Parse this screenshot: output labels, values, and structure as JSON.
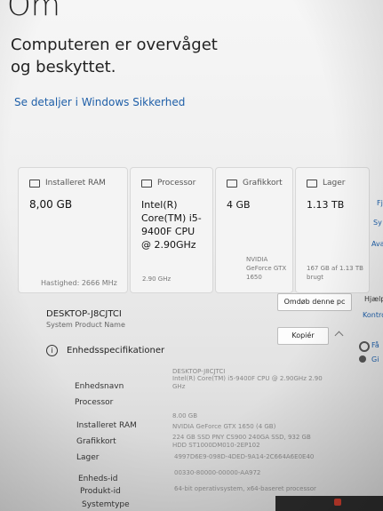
{
  "header": {
    "title": "Om",
    "status_headline": "Computeren er overvåget og beskyttet.",
    "security_link": "Se detaljer i Windows Sikkerhed"
  },
  "cards": [
    {
      "icon": "ram-icon",
      "label": "Installeret RAM",
      "value": "8,00 GB",
      "sub": ""
    },
    {
      "icon": "processor-icon",
      "label": "Processor",
      "value": "Intel(R) Core(TM) i5-9400F CPU @ 2.90GHz",
      "sub": ""
    },
    {
      "icon": "gpu-icon",
      "label": "Grafikkort",
      "value": "4 GB",
      "sub": "NVIDIA GeForce GTX 1650"
    },
    {
      "icon": "storage-icon",
      "label": "Lager",
      "value": "1.13 TB",
      "sub": "167 GB af 1.13 TB brugt"
    }
  ],
  "card_footers": {
    "ram_speed": "Hastighed: 2666 MHz",
    "cpu_speed": "2.90 GHz"
  },
  "side_links": {
    "fj": "Fj",
    "sy": "Sy",
    "ava": "Ava",
    "help": "Hjælp",
    "kontro": "Kontro",
    "fa": "Få",
    "gi": "Gi"
  },
  "device": {
    "name": "DESKTOP-J8CJTCI",
    "product": "System Product Name",
    "rename_button": "Omdøb denne pc"
  },
  "specs": {
    "section_title": "Enhedsspecifikationer",
    "copy_button": "Kopiér",
    "rows": [
      {
        "label": "Enhedsnavn",
        "value": "DESKTOP-J8CJTCI"
      },
      {
        "label": "Processor",
        "value": "Intel(R) Core(TM) i5-9400F CPU @ 2.90GHz 2.90 GHz"
      },
      {
        "label": "Installeret RAM",
        "value": "8.00 GB"
      },
      {
        "label": "Grafikkort",
        "value": "NVIDIA GeForce GTX 1650 (4 GB)"
      },
      {
        "label": "Lager",
        "value": "224 GB SSD PNY CS900 240GA SSD, 932 GB HDD ST1000DM010-2EP102"
      },
      {
        "label": "Enheds-id",
        "value": "4997D6E9-098D-4DED-9A14-2C664A6E0E40"
      },
      {
        "label": "Produkt-id",
        "value": "00330-80000-00000-AA972"
      },
      {
        "label": "Systemtype",
        "value": "64-bit operativsystem, x64-baseret processor"
      }
    ]
  }
}
